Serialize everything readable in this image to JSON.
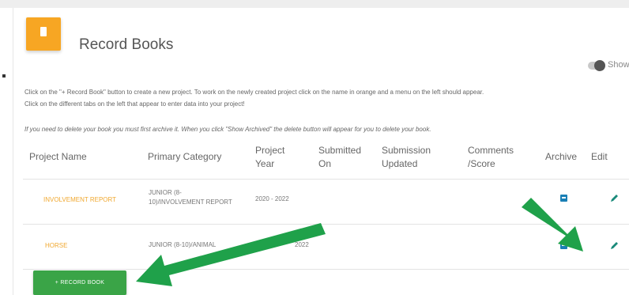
{
  "header": {
    "title": "Record Books",
    "icon": "book-icon",
    "accent": "#f7a623"
  },
  "toggle": {
    "label": "Show Ar",
    "state": "off"
  },
  "instructions": {
    "line1": "Click on the \"+ Record Book\" button to create a new project. To work on the newly created project click on the name in orange and a menu on the left should appear.",
    "line2": "Click on the different tabs on the left that appear to enter data into your project!",
    "note": "If you need to delete your book you must first archive it. When you click \"Show Archived\" the delete button will appear for you to delete your book."
  },
  "table": {
    "headers": {
      "project_name": "Project Name",
      "primary_category": "Primary Category",
      "project_year_1": "Project",
      "project_year_2": "Year",
      "submitted_1": "Submitted",
      "submitted_2": "On",
      "updated_1": "Submission",
      "updated_2": "Updated",
      "comments_1": "Comments",
      "comments_2": "/Score",
      "archive": "Archive",
      "edit": "Edit"
    },
    "rows": [
      {
        "name": "INVOLVEMENT REPORT",
        "category_1": "JUNIOR (8-",
        "category_2": "10)/INVOLVEMENT REPORT",
        "year": "2020 - 2022"
      },
      {
        "name": "HORSE",
        "category_1": "JUNIOR (8-10)/ANIMAL",
        "year": "2022"
      }
    ]
  },
  "button": {
    "label": "+ RECORD BOOK",
    "color": "#3aa447"
  },
  "colors": {
    "project_link": "#f0a830",
    "archive_icon": "#1a7fb5",
    "edit_icon": "#1a8a7a",
    "annotation_arrow": "#1fa14a"
  }
}
